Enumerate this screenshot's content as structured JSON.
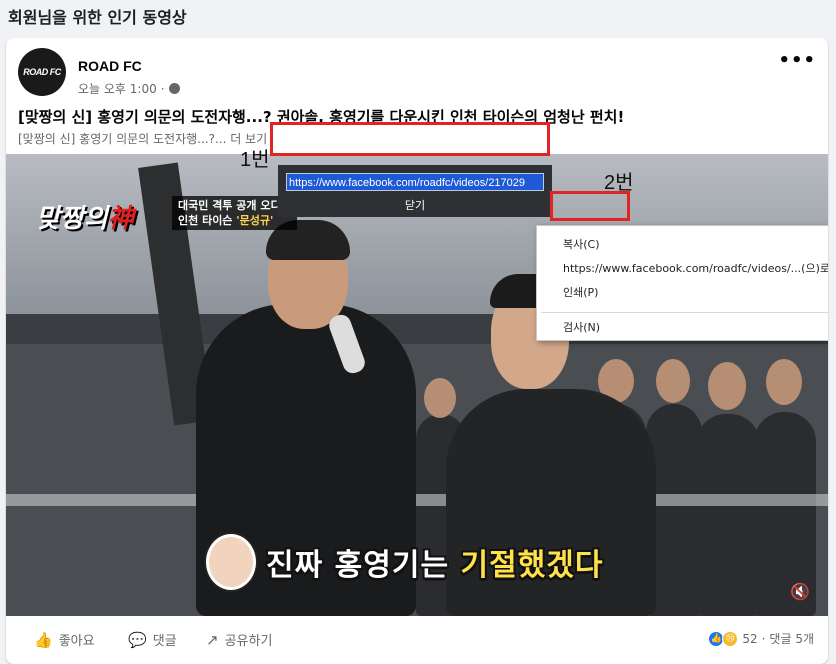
{
  "section": {
    "title": "회원님을 위한 인기 동영상"
  },
  "post": {
    "page_name": "ROAD FC",
    "avatar_text": "ROAD FC",
    "timestamp": "오늘 오후 1:00",
    "meta_separator": "·",
    "more_label": "•••",
    "headline": "[맞짱의 신] 홍영기 의문의 도전자행...? 권아솔, 홍영기를 다운시킨 인천 타이슨의 엄청난 펀치!",
    "caption": "[맞짱의 신] 홍영기 의문의 도전자행...?...",
    "caption_more": "더 보기"
  },
  "video": {
    "show_logo": "맞짱의",
    "show_logo_red": "神",
    "tag_line1": "대국민 격투 공개 오디션",
    "tag_line2_prefix": "인천 타이슨 ",
    "tag_line2_name": "'문성규'",
    "subtitle_part1": "진짜 홍영기는 ",
    "subtitle_part2": "기절했겠다",
    "volume_icon": "speaker-muted-icon"
  },
  "url_popup": {
    "url": "https://www.facebook.com/roadfc/videos/217029",
    "close_label": "닫기"
  },
  "context_menu": {
    "items": [
      {
        "label": "복사(C)"
      },
      {
        "label": "https://www.facebook.com/roadfc/videos/...(으)로 이"
      },
      {
        "label": "인쇄(P)"
      },
      {
        "label": "검사(N)"
      }
    ]
  },
  "annotations": {
    "label1": "1번",
    "label2": "2번",
    "box_color": "#e02424"
  },
  "actions": {
    "like": "좋아요",
    "comment": "댓글",
    "share": "공유하기",
    "reaction_count": "52",
    "comment_count": "댓글 5개",
    "separator": "·"
  }
}
